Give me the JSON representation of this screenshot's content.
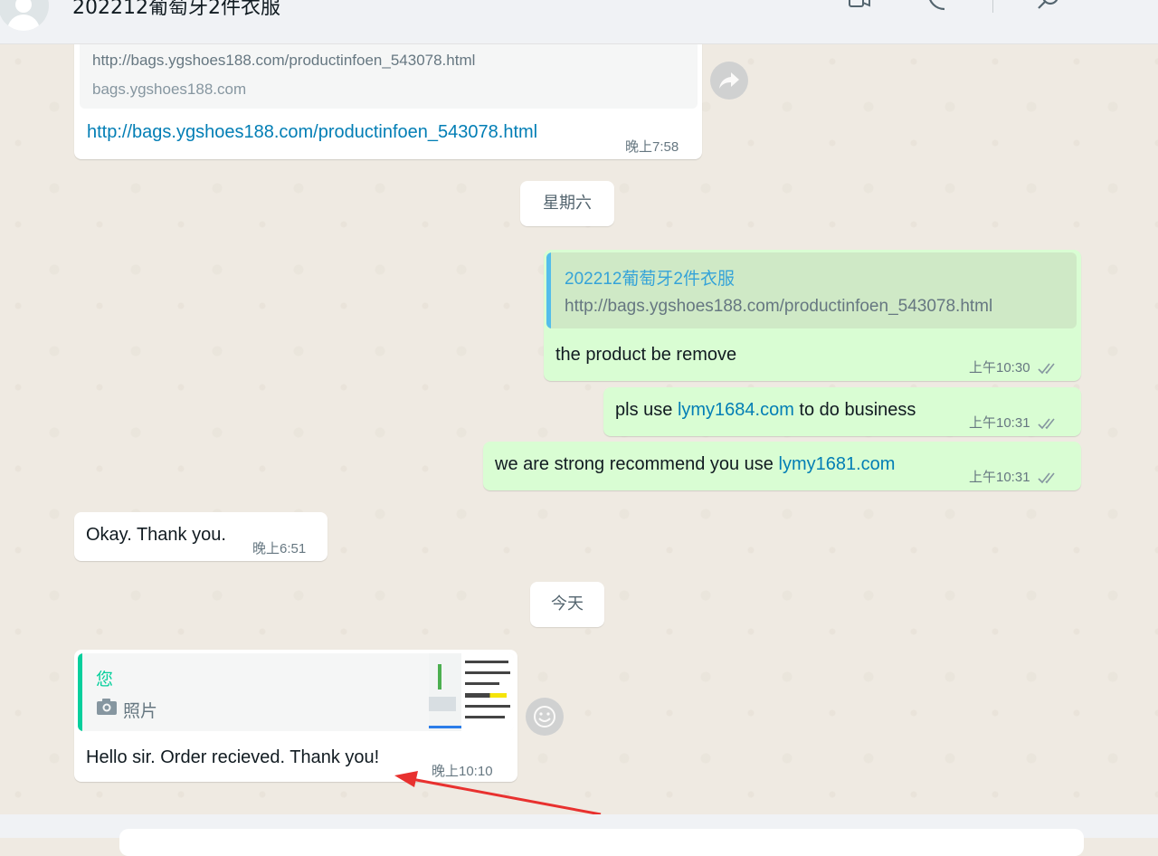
{
  "header": {
    "title": "202212葡萄牙2件衣服"
  },
  "messages": {
    "m1": {
      "preview_url": "http://bags.ygshoes188.com/productinfoen_543078.html",
      "preview_domain": "bags.ygshoes188.com",
      "link": "http://bags.ygshoes188.com/productinfoen_543078.html",
      "time": "晚上7:58"
    },
    "date1": "星期六",
    "m2": {
      "quote_title": "202212葡萄牙2件衣服",
      "quote_text": "http://bags.ygshoes188.com/productinfoen_543078.html",
      "text": "the product be remove",
      "time": "上午10:30"
    },
    "m3": {
      "text_before": "pls use ",
      "link": "lymy1684.com",
      "text_after": " to do business",
      "time": "上午10:31"
    },
    "m4": {
      "text_before": "we are strong recommend you use ",
      "link": "lymy1681.com",
      "time": "上午10:31"
    },
    "m5": {
      "text": "Okay. Thank you.",
      "time": "晚上6:51"
    },
    "date2": "今天",
    "m6": {
      "quote_sender": "您",
      "quote_label": "照片",
      "text": "Hello sir. Order recieved. Thank you!",
      "time": "晚上10:10"
    }
  },
  "colors": {
    "outgoing_bubble": "#d9fdd3",
    "incoming_bubble": "#ffffff",
    "link": "#027eb5",
    "quote_bar_out": "#53bdeb",
    "quote_bar_in": "#06cf9c",
    "annotation_arrow": "#e8312f"
  }
}
